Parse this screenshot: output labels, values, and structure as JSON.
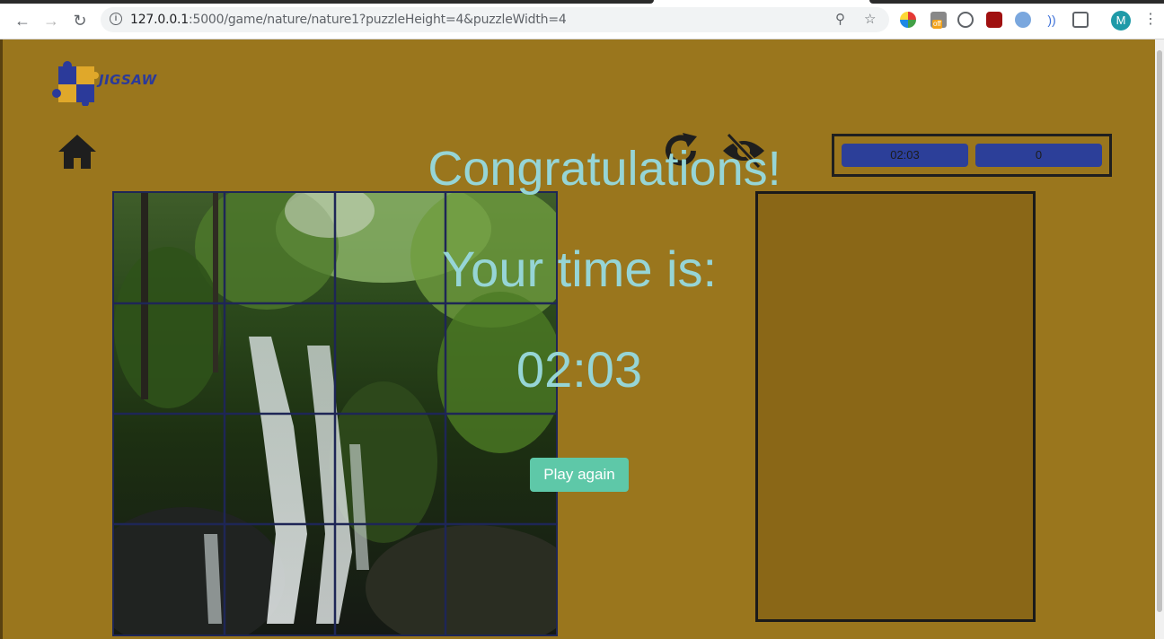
{
  "browser": {
    "url_host": "127.0.0.1",
    "url_rest": ":5000/game/nature/nature1?puzzleHeight=4&puzzleWidth=4",
    "avatar_letter": "M",
    "extension_badge": "off"
  },
  "app": {
    "logo_text": "JIGSAW"
  },
  "stats": {
    "timer": "02:03",
    "moves": "0"
  },
  "overlay": {
    "title": "Congratulations!",
    "subtitle": "Your time is:",
    "time": "02:03",
    "play_again_label": "Play again"
  },
  "puzzle": {
    "rows": 4,
    "cols": 4,
    "grid_color": "#1e2656"
  },
  "colors": {
    "background": "#9a761d",
    "tray": "#8a6717",
    "stat_bg": "#2c3f99",
    "overlay_text": "#96d5d6",
    "button": "#5ec8a8"
  }
}
